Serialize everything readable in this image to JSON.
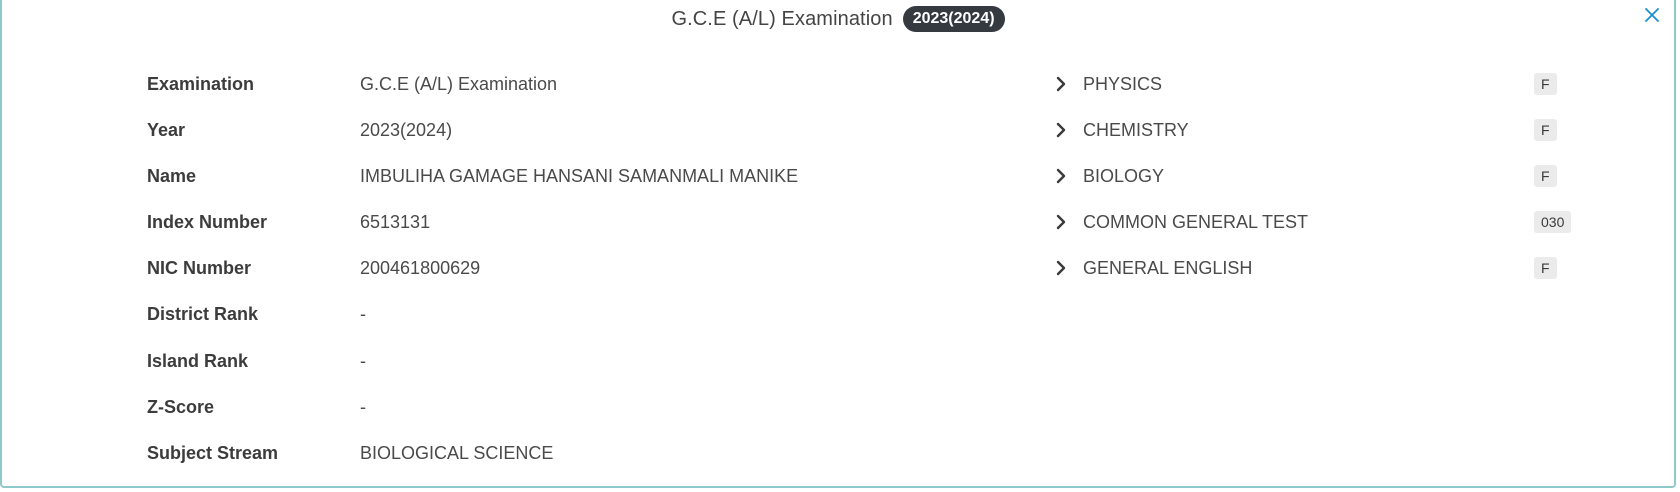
{
  "header": {
    "title": "G.C.E (A/L) Examination",
    "year_badge": "2023(2024)",
    "close_icon": "close-icon"
  },
  "info": [
    {
      "label": "Examination",
      "value": "G.C.E (A/L) Examination"
    },
    {
      "label": "Year",
      "value": "2023(2024)"
    },
    {
      "label": "Name",
      "value": "IMBULIHA GAMAGE HANSANI SAMANMALI MANIKE"
    },
    {
      "label": "Index Number",
      "value": "6513131"
    },
    {
      "label": "NIC Number",
      "value": "200461800629"
    },
    {
      "label": "District Rank",
      "value": "-"
    },
    {
      "label": "Island Rank",
      "value": "-"
    },
    {
      "label": "Z-Score",
      "value": "-"
    },
    {
      "label": "Subject Stream",
      "value": "BIOLOGICAL SCIENCE"
    }
  ],
  "subjects": [
    {
      "name": "PHYSICS",
      "grade": "F"
    },
    {
      "name": "CHEMISTRY",
      "grade": "F"
    },
    {
      "name": "BIOLOGY",
      "grade": "F"
    },
    {
      "name": "COMMON GENERAL TEST",
      "grade": "030"
    },
    {
      "name": "GENERAL ENGLISH",
      "grade": "F"
    }
  ],
  "colors": {
    "badge_bg": "#343a40",
    "close_icon": "#1a8fd1",
    "border": "#8fc9cc",
    "grade_bg": "#ebebeb"
  }
}
